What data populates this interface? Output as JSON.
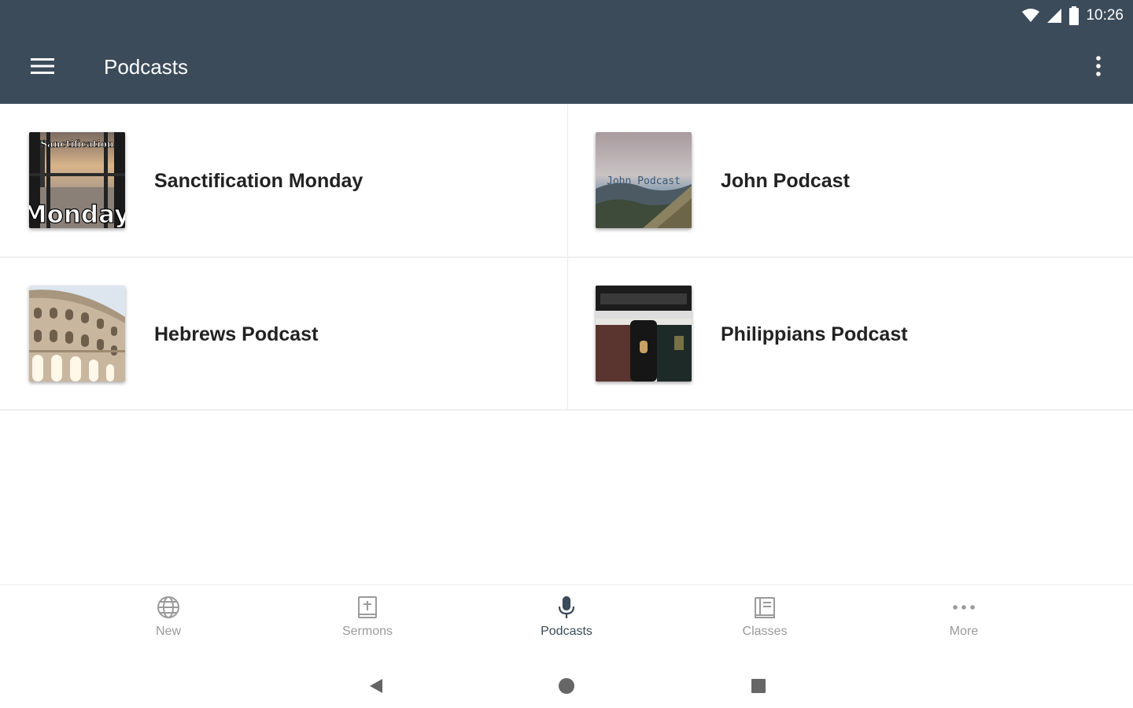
{
  "status_bar": {
    "time": "10:26"
  },
  "app_bar": {
    "title": "Podcasts",
    "menu_icon": "hamburger-menu-icon",
    "overflow_icon": "more-vert-icon"
  },
  "podcasts": [
    {
      "title": "Sanctification Monday",
      "art_top_text": "Sanctification",
      "art_bottom_text": "Monday"
    },
    {
      "title": "John Podcast",
      "art_text": "John Podcast"
    },
    {
      "title": "Hebrews Podcast"
    },
    {
      "title": "Philippians Podcast"
    }
  ],
  "bottom_nav": {
    "items": [
      {
        "label": "New",
        "icon": "globe-icon"
      },
      {
        "label": "Sermons",
        "icon": "bible-icon"
      },
      {
        "label": "Podcasts",
        "icon": "microphone-icon",
        "active": true
      },
      {
        "label": "Classes",
        "icon": "book-icon"
      },
      {
        "label": "More",
        "icon": "more-horiz-icon"
      }
    ]
  },
  "colors": {
    "app_bar": "#3b4b5a",
    "active_nav": "#3b4b5a",
    "inactive_nav": "#9a9a9a"
  }
}
